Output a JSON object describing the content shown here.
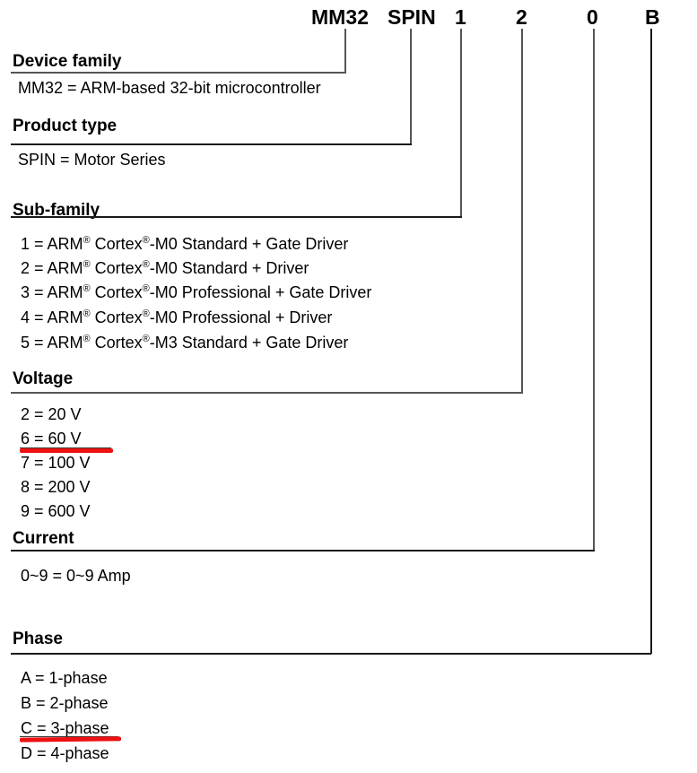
{
  "part_number": {
    "segments": [
      {
        "code": "MM32",
        "field": "Device family"
      },
      {
        "code": "SPIN",
        "field": "Product type"
      },
      {
        "code": "1",
        "field": "Sub-family"
      },
      {
        "code": "2",
        "field": "Voltage"
      },
      {
        "code": "0",
        "field": "Current"
      },
      {
        "code": "B",
        "field": "Phase"
      }
    ]
  },
  "sections": {
    "device_family": {
      "heading": "Device family",
      "options": [
        "MM32 = ARM-based 32-bit microcontroller"
      ]
    },
    "product_type": {
      "heading": "Product type",
      "options": [
        "SPIN = Motor Series"
      ]
    },
    "sub_family": {
      "heading": "Sub-family",
      "options": [
        {
          "pre": "1 = ARM",
          "mid": " Cortex",
          "post": "-M0 Standard + Gate Driver"
        },
        {
          "pre": "2 = ARM",
          "mid": " Cortex",
          "post": "-M0 Standard + Driver"
        },
        {
          "pre": "3 = ARM",
          "mid": " Cortex",
          "post": "-M0 Professional + Gate Driver"
        },
        {
          "pre": "4 = ARM",
          "mid": " Cortex",
          "post": "-M0 Professional + Driver"
        },
        {
          "pre": "5 = ARM",
          "mid": " Cortex",
          "post": "-M3 Standard + Gate Driver"
        }
      ],
      "registered_mark": "®"
    },
    "voltage": {
      "heading": "Voltage",
      "options": [
        {
          "label": "2 = 20 V",
          "highlighted": false
        },
        {
          "label": "6 = 60 V",
          "highlighted": true
        },
        {
          "label": "7 = 100 V",
          "highlighted": false
        },
        {
          "label": "8 = 200 V",
          "highlighted": false
        },
        {
          "label": "9 = 600 V",
          "highlighted": false
        }
      ]
    },
    "current": {
      "heading": "Current",
      "options": [
        "0~9 = 0~9 Amp"
      ]
    },
    "phase": {
      "heading": "Phase",
      "options": [
        {
          "label": "A = 1-phase",
          "highlighted": false
        },
        {
          "label": "B = 2-phase",
          "highlighted": false
        },
        {
          "label": "C = 3-phase",
          "highlighted": true
        },
        {
          "label": "D = 4-phase",
          "highlighted": false
        }
      ]
    }
  },
  "colors": {
    "highlight": "#ee1111",
    "rule": "#1a1a1a",
    "text": "#000000"
  }
}
